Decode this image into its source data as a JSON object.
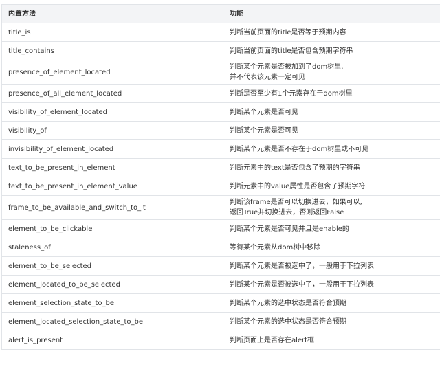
{
  "table": {
    "headers": [
      "内置方法",
      "功能"
    ],
    "rows": [
      {
        "method": "title_is",
        "desc": [
          "判断当前页面的title是否等于预期内容"
        ]
      },
      {
        "method": "title_contains",
        "desc": [
          "判断当前页面的title是否包含预期字符串"
        ]
      },
      {
        "method": "presence_of_element_located",
        "desc": [
          "判断某个元素是否被加到了dom树里,",
          "并不代表该元素一定可见"
        ]
      },
      {
        "method": "presence_of_all_element_located",
        "desc": [
          "判断是否至少有1个元素存在于dom树里"
        ]
      },
      {
        "method": "visibility_of_element_located",
        "desc": [
          "判断某个元素是否可见"
        ]
      },
      {
        "method": "visibility_of",
        "desc": [
          "判断某个元素是否可见"
        ]
      },
      {
        "method": "invisibility_of_element_located",
        "desc": [
          "判断某个元素是否不存在于dom树里或不可见"
        ]
      },
      {
        "method": "text_to_be_present_in_element",
        "desc": [
          "判断元素中的text是否包含了预期的字符串"
        ]
      },
      {
        "method": "text_to_be_present_in_element_value",
        "desc": [
          "判断元素中的value属性是否包含了预期字符"
        ]
      },
      {
        "method": "frame_to_be_available_and_switch_to_it",
        "desc": [
          "判断该frame是否可以切换进去，如果可以,",
          "返回True并切换进去，否则返回False"
        ]
      },
      {
        "method": "element_to_be_clickable",
        "desc": [
          "判断某个元素是否可见并且是enable的"
        ]
      },
      {
        "method": "staleness_of",
        "desc": [
          "等待某个元素从dom树中移除"
        ]
      },
      {
        "method": "element_to_be_selected",
        "desc": [
          "判断某个元素是否被选中了，一般用于下拉列表"
        ]
      },
      {
        "method": "element_located_to_be_selected",
        "desc": [
          "判断某个元素是否被选中了，一般用于下拉列表"
        ]
      },
      {
        "method": "element_selection_state_to_be",
        "desc": [
          "判断某个元素的选中状态是否符合预期"
        ]
      },
      {
        "method": "element_located_selection_state_to_be",
        "desc": [
          "判断某个元素的选中状态是否符合预期"
        ]
      },
      {
        "method": "alert_is_present",
        "desc": [
          "判断页面上是否存在alert框"
        ]
      }
    ]
  }
}
